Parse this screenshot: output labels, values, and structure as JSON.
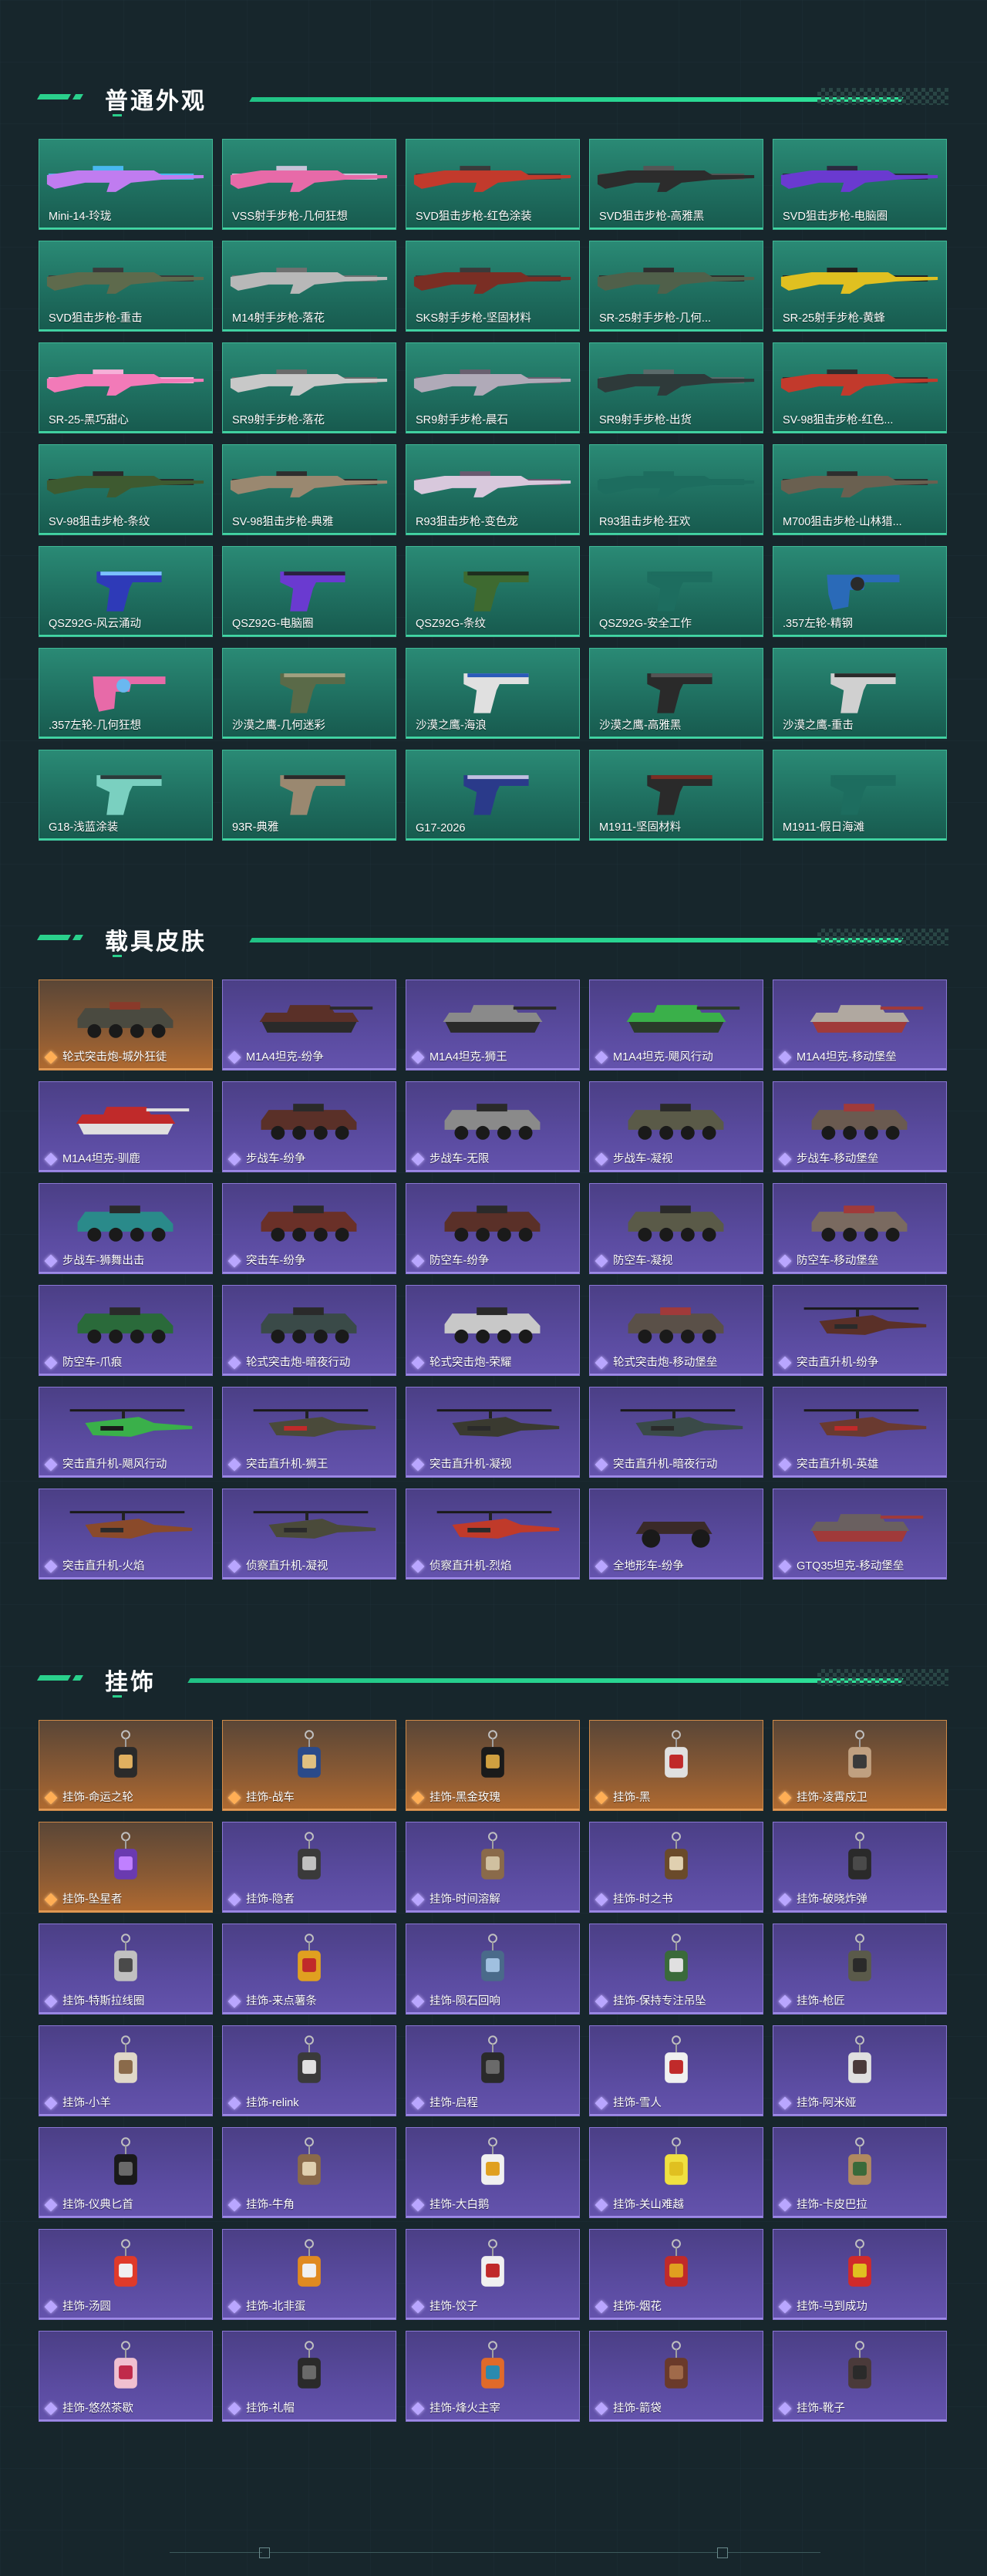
{
  "sections": [
    {
      "title": "普通外观",
      "variant": "weapon",
      "items": [
        {
          "label": "Mini-14-玲珑",
          "kind": "rifle",
          "color": "#c07cf0",
          "color2": "#48b8f0"
        },
        {
          "label": "VSS射手步枪-几何狂想",
          "kind": "rifle",
          "color": "#e76aa8",
          "color2": "#c7c3d8"
        },
        {
          "label": "SVD狙击步枪-红色涂装",
          "kind": "rifle",
          "color": "#c23a2c",
          "color2": "#3a3a3a"
        },
        {
          "label": "SVD狙击步枪-高雅黑",
          "kind": "rifle",
          "color": "#2c2c2c",
          "color2": "#555"
        },
        {
          "label": "SVD狙击步枪-电脑圈",
          "kind": "rifle",
          "color": "#6a3ad0",
          "color2": "#2a2a40"
        },
        {
          "label": "SVD狙击步枪-重击",
          "kind": "rifle",
          "color": "#5e6a4c",
          "color2": "#3a3a3a"
        },
        {
          "label": "M14射手步枪-落花",
          "kind": "rifle",
          "color": "#b8b8b8",
          "color2": "#707070"
        },
        {
          "label": "SKS射手步枪-坚固材料",
          "kind": "rifle",
          "color": "#7a2e24",
          "color2": "#3a3a3a"
        },
        {
          "label": "SR-25射手步枪-几何...",
          "kind": "rifle",
          "color": "#50604a",
          "color2": "#2e2e2e"
        },
        {
          "label": "SR-25射手步枪-黄蜂",
          "kind": "rifle",
          "color": "#e0c020",
          "color2": "#202020"
        },
        {
          "label": "SR-25-黑巧甜心",
          "kind": "rifle",
          "color": "#f27ab8",
          "color2": "#f6b0d8"
        },
        {
          "label": "SR9射手步枪-落花",
          "kind": "rifle",
          "color": "#c8c8c8",
          "color2": "#6a6a6a"
        },
        {
          "label": "SR9射手步枪-晨石",
          "kind": "rifle",
          "color": "#b0aab8",
          "color2": "#6a6070"
        },
        {
          "label": "SR9射手步枪-出货",
          "kind": "rifle",
          "color": "#2e3a3a",
          "color2": "#5a6a6a"
        },
        {
          "label": "SV-98狙击步枪-红色...",
          "kind": "rifle",
          "color": "#c23a2c",
          "color2": "#2e2e2e"
        },
        {
          "label": "SV-98狙击步枪-条纹",
          "kind": "rifle",
          "color": "#3e5a30",
          "color2": "#2a2a2a"
        },
        {
          "label": "SV-98狙击步枪-典雅",
          "kind": "rifle",
          "color": "#9a8870",
          "color2": "#2e2e2e"
        },
        {
          "label": "R93狙击步枪-变色龙",
          "kind": "rifle",
          "color": "#d8c8dc",
          "color2": "#6a5a70"
        },
        {
          "label": "R93狙击步枪-狂欢",
          "kind": "rifle",
          "color": "#1d6d5f",
          "color2": "#1d6d5f"
        },
        {
          "label": "M700狙击步枪-山林猎...",
          "kind": "rifle",
          "color": "#6a6050",
          "color2": "#2e2e2e"
        },
        {
          "label": "QSZ92G-风云涌动",
          "kind": "pistol",
          "color": "#2e3ab8",
          "color2": "#7ac0ff"
        },
        {
          "label": "QSZ92G-电脑圈",
          "kind": "pistol",
          "color": "#6a3ad0",
          "color2": "#2a2040"
        },
        {
          "label": "QSZ92G-条纹",
          "kind": "pistol",
          "color": "#3e6a30",
          "color2": "#1e2e1e"
        },
        {
          "label": "QSZ92G-安全工作",
          "kind": "pistol",
          "color": "#1d6d5f",
          "color2": "#1d6d5f"
        },
        {
          "label": ".357左轮-精钢",
          "kind": "revolver",
          "color": "#2a6ab8",
          "color2": "#2a2a2a"
        },
        {
          "label": ".357左轮-几何狂想",
          "kind": "revolver",
          "color": "#e76aa8",
          "color2": "#6ab8f0"
        },
        {
          "label": "沙漠之鹰-几何迷彩",
          "kind": "pistol",
          "color": "#5a6a48",
          "color2": "#a0a080"
        },
        {
          "label": "沙漠之鹰-海浪",
          "kind": "pistol",
          "color": "#e0e0e0",
          "color2": "#2a5ab8"
        },
        {
          "label": "沙漠之鹰-高雅黑",
          "kind": "pistol",
          "color": "#2a2a2a",
          "color2": "#555555"
        },
        {
          "label": "沙漠之鹰-重击",
          "kind": "pistol",
          "color": "#d0d0d0",
          "color2": "#2a2a2a"
        },
        {
          "label": "G18-浅蓝涂装",
          "kind": "pistol",
          "color": "#7ad0c0",
          "color2": "#2a3a3a"
        },
        {
          "label": "93R-典雅",
          "kind": "pistol",
          "color": "#9a8870",
          "color2": "#2a2a2a"
        },
        {
          "label": "G17-2026",
          "kind": "pistol",
          "color": "#2a3a8a",
          "color2": "#c0c0e0"
        },
        {
          "label": "M1911-坚固材料",
          "kind": "pistol",
          "color": "#2a2a2a",
          "color2": "#7a2e24"
        },
        {
          "label": "M1911-假日海滩",
          "kind": "pistol",
          "color": "#1d6d5f",
          "color2": "#1d6d5f"
        }
      ]
    },
    {
      "title": "载具皮肤",
      "variant": "vehicle",
      "items": [
        {
          "label": "轮式突击炮-城外狂徒",
          "kind": "armored",
          "rarity": "orange",
          "color": "#4a4a40",
          "color2": "#8a3a2a"
        },
        {
          "label": "M1A4坦克-纷争",
          "kind": "tank",
          "rarity": "purple",
          "color": "#5a3028",
          "color2": "#2a2a2a"
        },
        {
          "label": "M1A4坦克-狮王",
          "kind": "tank",
          "rarity": "purple",
          "color": "#8a8a8a",
          "color2": "#2a2a2a"
        },
        {
          "label": "M1A4坦克-飓风行动",
          "kind": "tank",
          "rarity": "purple",
          "color": "#3ab04a",
          "color2": "#2a3a2a"
        },
        {
          "label": "M1A4坦克-移动堡垒",
          "kind": "tank",
          "rarity": "purple",
          "color": "#b0a8a0",
          "color2": "#a03a3a"
        },
        {
          "label": "M1A4坦克-驯鹿",
          "kind": "tank",
          "rarity": "purple",
          "color": "#c02a2a",
          "color2": "#e0e0e0"
        },
        {
          "label": "步战车-纷争",
          "kind": "ifv",
          "rarity": "purple",
          "color": "#5a3028",
          "color2": "#2a2a2a"
        },
        {
          "label": "步战车-无限",
          "kind": "ifv",
          "rarity": "purple",
          "color": "#8a8a8a",
          "color2": "#2a2a2a"
        },
        {
          "label": "步战车-凝视",
          "kind": "ifv",
          "rarity": "purple",
          "color": "#5a5a48",
          "color2": "#2a2a2a"
        },
        {
          "label": "步战车-移动堡垒",
          "kind": "ifv",
          "rarity": "purple",
          "color": "#6a5a50",
          "color2": "#a03a3a"
        },
        {
          "label": "步战车-狮舞出击",
          "kind": "ifv",
          "rarity": "purple",
          "color": "#2a8a8a",
          "color2": "#2a2a2a"
        },
        {
          "label": "突击车-纷争",
          "kind": "ifv",
          "rarity": "purple",
          "color": "#6a3028",
          "color2": "#2a2a2a"
        },
        {
          "label": "防空车-纷争",
          "kind": "ifv",
          "rarity": "purple",
          "color": "#5a3028",
          "color2": "#2a2a2a"
        },
        {
          "label": "防空车-凝视",
          "kind": "ifv",
          "rarity": "purple",
          "color": "#5a5a48",
          "color2": "#2a2a2a"
        },
        {
          "label": "防空车-移动堡垒",
          "kind": "ifv",
          "rarity": "purple",
          "color": "#7a6a60",
          "color2": "#a03a3a"
        },
        {
          "label": "防空车-爪痕",
          "kind": "armored",
          "rarity": "purple",
          "color": "#2a6a3a",
          "color2": "#2a2a2a"
        },
        {
          "label": "轮式突击炮-暗夜行动",
          "kind": "armored",
          "rarity": "purple",
          "color": "#3a4a48",
          "color2": "#2a2a2a"
        },
        {
          "label": "轮式突击炮-荣耀",
          "kind": "armored",
          "rarity": "purple",
          "color": "#c8c8c8",
          "color2": "#2a2a2a"
        },
        {
          "label": "轮式突击炮-移动堡垒",
          "kind": "armored",
          "rarity": "purple",
          "color": "#5a5048",
          "color2": "#a03a3a"
        },
        {
          "label": "突击直升机-纷争",
          "kind": "heli",
          "rarity": "purple",
          "color": "#5a3028",
          "color2": "#2a2a2a"
        },
        {
          "label": "突击直升机-飓风行动",
          "kind": "heli",
          "rarity": "purple",
          "color": "#3ab04a",
          "color2": "#1a1a1a"
        },
        {
          "label": "突击直升机-狮王",
          "kind": "heli",
          "rarity": "purple",
          "color": "#4a4a3a",
          "color2": "#c02a2a"
        },
        {
          "label": "突击直升机-凝视",
          "kind": "heli",
          "rarity": "purple",
          "color": "#3a3a30",
          "color2": "#2a2a2a"
        },
        {
          "label": "突击直升机-暗夜行动",
          "kind": "heli",
          "rarity": "purple",
          "color": "#3a4a48",
          "color2": "#2a2a2a"
        },
        {
          "label": "突击直升机-英雄",
          "kind": "heli",
          "rarity": "purple",
          "color": "#6a3a30",
          "color2": "#c02a2a"
        },
        {
          "label": "突击直升机-火焰",
          "kind": "heli",
          "rarity": "purple",
          "color": "#8a4a2a",
          "color2": "#2a2a2a"
        },
        {
          "label": "侦察直升机-凝视",
          "kind": "heli",
          "rarity": "purple",
          "color": "#4a4a3a",
          "color2": "#2a2a2a"
        },
        {
          "label": "侦察直升机-烈焰",
          "kind": "heli",
          "rarity": "purple",
          "color": "#c03a2a",
          "color2": "#2a2a2a"
        },
        {
          "label": "全地形车-纷争",
          "kind": "atv",
          "rarity": "purple",
          "color": "#3a2a28",
          "color2": "#1a1a1a"
        },
        {
          "label": "GTQ35坦克-移动堡垒",
          "kind": "tank",
          "rarity": "purple",
          "color": "#6a6060",
          "color2": "#a03a3a"
        }
      ]
    },
    {
      "title": "挂饰",
      "variant": "charm",
      "items": [
        {
          "label": "挂饰-命运之轮",
          "rarity": "orange",
          "color": "#2a2a2a",
          "color2": "#e0b060"
        },
        {
          "label": "挂饰-战车",
          "rarity": "orange",
          "color": "#2a4a8a",
          "color2": "#e0c080"
        },
        {
          "label": "挂饰-黑金玫瑰",
          "rarity": "orange",
          "color": "#1a1a1a",
          "color2": "#d0a040"
        },
        {
          "label": "挂饰-黑",
          "rarity": "orange",
          "color": "#e0e0e0",
          "color2": "#c02a2a"
        },
        {
          "label": "挂饰-凌霄戍卫",
          "rarity": "orange",
          "color": "#c0a080",
          "color2": "#3a3a3a"
        },
        {
          "label": "挂饰-坠星者",
          "rarity": "orange",
          "color": "#6a3ab0",
          "color2": "#c080ff"
        },
        {
          "label": "挂饰-隐者",
          "rarity": "purple",
          "color": "#3a3a3a",
          "color2": "#c0c0c0"
        },
        {
          "label": "挂饰-时间溶解",
          "rarity": "purple",
          "color": "#8a6a4a",
          "color2": "#d0c0a0"
        },
        {
          "label": "挂饰-时之书",
          "rarity": "purple",
          "color": "#6a4a2a",
          "color2": "#e0d0b0"
        },
        {
          "label": "挂饰-破晓炸弹",
          "rarity": "purple",
          "color": "#2a2a2a",
          "color2": "#4a4a4a"
        },
        {
          "label": "挂饰-特斯拉线圈",
          "rarity": "purple",
          "color": "#c0c0c0",
          "color2": "#4a4a4a"
        },
        {
          "label": "挂饰-来点薯条",
          "rarity": "purple",
          "color": "#e0a020",
          "color2": "#c02a2a"
        },
        {
          "label": "挂饰-陨石回响",
          "rarity": "purple",
          "color": "#4a6a8a",
          "color2": "#a0c0e0"
        },
        {
          "label": "挂饰-保持专注吊坠",
          "rarity": "purple",
          "color": "#3a6a3a",
          "color2": "#e0e0e0"
        },
        {
          "label": "挂饰-枪匠",
          "rarity": "purple",
          "color": "#5a5a4a",
          "color2": "#2a2a2a"
        },
        {
          "label": "挂饰-小羊",
          "rarity": "purple",
          "color": "#e0d8c8",
          "color2": "#8a6a4a"
        },
        {
          "label": "挂饰-relink",
          "rarity": "purple",
          "color": "#3a3a3a",
          "color2": "#e0e0e0"
        },
        {
          "label": "挂饰-启程",
          "rarity": "purple",
          "color": "#2a2a2a",
          "color2": "#6a6a6a"
        },
        {
          "label": "挂饰-雪人",
          "rarity": "purple",
          "color": "#f0f0f0",
          "color2": "#c02a2a"
        },
        {
          "label": "挂饰-阿米娅",
          "rarity": "purple",
          "color": "#e0e0e0",
          "color2": "#4a3a3a"
        },
        {
          "label": "挂饰-仪典匕首",
          "rarity": "purple",
          "color": "#1a1a1a",
          "color2": "#6a6a6a"
        },
        {
          "label": "挂饰-牛角",
          "rarity": "purple",
          "color": "#8a6a4a",
          "color2": "#e0d0b0"
        },
        {
          "label": "挂饰-大白鹅",
          "rarity": "purple",
          "color": "#f0f0f0",
          "color2": "#e0a020"
        },
        {
          "label": "挂饰-关山难越",
          "rarity": "purple",
          "color": "#f0e040",
          "color2": "#e0c020"
        },
        {
          "label": "挂饰-卡皮巴拉",
          "rarity": "purple",
          "color": "#b08a60",
          "color2": "#3a6a3a"
        },
        {
          "label": "挂饰-汤圆",
          "rarity": "purple",
          "color": "#e03a2a",
          "color2": "#f0f0f0"
        },
        {
          "label": "挂饰-北非蛋",
          "rarity": "purple",
          "color": "#e08a20",
          "color2": "#f0f0f0"
        },
        {
          "label": "挂饰-饺子",
          "rarity": "purple",
          "color": "#f0f0f0",
          "color2": "#c02a2a"
        },
        {
          "label": "挂饰-烟花",
          "rarity": "purple",
          "color": "#c02a2a",
          "color2": "#e0a020"
        },
        {
          "label": "挂饰-马到成功",
          "rarity": "purple",
          "color": "#d02a2a",
          "color2": "#e0c020"
        },
        {
          "label": "挂饰-悠然茶歇",
          "rarity": "purple",
          "color": "#f0c0d0",
          "color2": "#c02a4a"
        },
        {
          "label": "挂饰-礼帽",
          "rarity": "purple",
          "color": "#2a2a2a",
          "color2": "#6a6a6a"
        },
        {
          "label": "挂饰-烽火主宰",
          "rarity": "purple",
          "color": "#e06a2a",
          "color2": "#2a8ab0"
        },
        {
          "label": "挂饰-箭袋",
          "rarity": "purple",
          "color": "#6a3a2a",
          "color2": "#a06a4a"
        },
        {
          "label": "挂饰-靴子",
          "rarity": "purple",
          "color": "#4a3a3a",
          "color2": "#2a2a2a"
        }
      ]
    }
  ]
}
